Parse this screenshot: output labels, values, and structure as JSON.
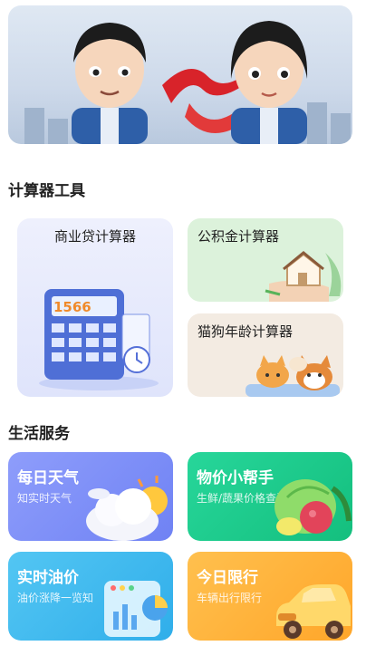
{
  "sections": {
    "calculator_title": "计算器工具",
    "life_title": "生活服务"
  },
  "calculators": {
    "commercial_loan": "商业贷计算器",
    "commercial_display": "1566",
    "provident_fund": "公积金计算器",
    "pet_age": "猫狗年龄计算器"
  },
  "services": {
    "weather": {
      "title": "每日天气",
      "subtitle": "知实时天气"
    },
    "price": {
      "title": "物价小帮手",
      "subtitle": "生鲜/蔬果价格查询"
    },
    "oil": {
      "title": "实时油价",
      "subtitle": "油价涨降一览知"
    },
    "traffic": {
      "title": "今日限行",
      "subtitle": "车辆出行限行"
    }
  },
  "colors": {
    "weather": "#7b8ff7",
    "price": "#1fc98a",
    "oil": "#3cb8ef",
    "traffic": "#ffb13b"
  }
}
